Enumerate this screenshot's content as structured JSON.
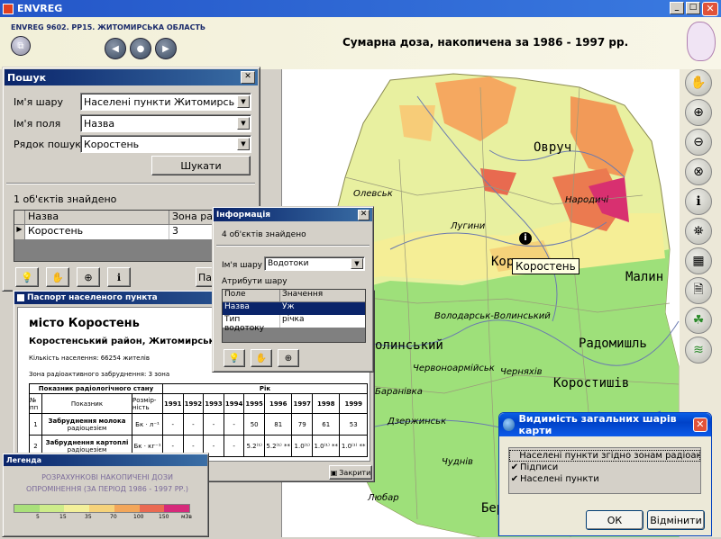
{
  "app": {
    "title": "ENVREG",
    "subtitle": "ENVREG 9602. PP15. ЖИТОМИРСЬКА ОБЛАСТЬ",
    "map_title": "Сумарна доза, накопичена за 1986 - 1997 рр."
  },
  "search": {
    "title": "Пошук",
    "layer_label": "Ім'я шару",
    "layer_value": "Населені пункти Житомирської області",
    "field_label": "Ім'я поля",
    "field_value": "Назва",
    "row_label": "Рядок пошуку",
    "row_value": "Коростень",
    "search_button": "Шукати",
    "found": "1 об'єктів знайдено",
    "col_name": "Назва",
    "col_zone": "Зона радіо",
    "row_name": "Коростень",
    "row_zone": "3",
    "pass_button": "Пас"
  },
  "info": {
    "title": "Інформація",
    "found": "4 об'єктів знайдено",
    "layer_label": "Ім'я шару",
    "layer_value": "Водотоки",
    "attrs_label": "Атрибути шару",
    "col_field": "Поле",
    "col_value": "Значення",
    "rows": [
      {
        "f": "Назва",
        "v": "Уж"
      },
      {
        "f": "Тип водотоку",
        "v": "річка"
      }
    ]
  },
  "passport": {
    "title": "Паспорт населеного пункта",
    "city": "місто Коростень",
    "district": "Коростенський район, Житомирська область",
    "population": "Кількість населення: 66254 жителів",
    "zone": "Зона радіоактивного забруднення: 3 зона",
    "th_indicator": "Показник радіологічного стану",
    "th_no": "№ пп",
    "th_name": "Показник",
    "th_dim": "Розмір-ність",
    "th_year": "Рік",
    "years": [
      "1991",
      "1992",
      "1993",
      "1994",
      "1995",
      "1996",
      "1997",
      "1998",
      "1999"
    ],
    "rows": [
      {
        "no": "1",
        "name": "Забруднення молока",
        "sub": "радіоцезієм",
        "dim": "Бк · л⁻¹",
        "vals": [
          "-",
          "-",
          "-",
          "-",
          "50",
          "81",
          "79",
          "61",
          "53"
        ]
      },
      {
        "no": "2",
        "name": "Забруднення картоплі",
        "sub": "радіоцезієм",
        "dim": "Бк · кг⁻¹",
        "vals": [
          "-",
          "-",
          "-",
          "-",
          "5.2⁽¹⁾",
          "5.2⁽¹⁾ **",
          "1.0⁽¹⁾",
          "1.0⁽¹⁾ **",
          "1.0⁽¹⁾ **"
        ]
      }
    ],
    "close_button": "Закрити"
  },
  "legend": {
    "title": "Легенда",
    "heading": "РОЗРАХУНКОВІ НАКОПИЧЕНІ ДОЗИ ОПРОМІНЕННЯ (ЗА ПЕРІОД 1986 - 1997 РР.)",
    "ticks": [
      "5",
      "15",
      "35",
      "70",
      "100",
      "150"
    ],
    "unit": "мЗв",
    "colors": [
      "#a9e07a",
      "#cdec8a",
      "#f3f09a",
      "#f5d27a",
      "#f2a65a",
      "#ea6a52",
      "#d62a7a"
    ]
  },
  "visibility": {
    "title": "Видимість загальних шарів карти",
    "items": [
      {
        "label": "Населені пункти згідно зонам радіоактивно",
        "checked": false
      },
      {
        "label": "Підписи",
        "checked": true
      },
      {
        "label": "Населені пункти",
        "checked": true
      }
    ],
    "ok": "ОК",
    "cancel": "Відмінити"
  },
  "map": {
    "cities_big": [
      "Овруч",
      "Коростень",
      "Малин",
      "Радомишль",
      "Коростишів",
      "Бер"
    ],
    "cities_small": [
      "Олевськ",
      "Народичі",
      "Лугини",
      "Володарськ-Волинський",
      "Червоноармійськ",
      "Черняхів",
      "Дзержинськ",
      "Чуднів",
      "Любар",
      "Баранівка",
      "олинський"
    ],
    "tooltip": "Коростень"
  }
}
